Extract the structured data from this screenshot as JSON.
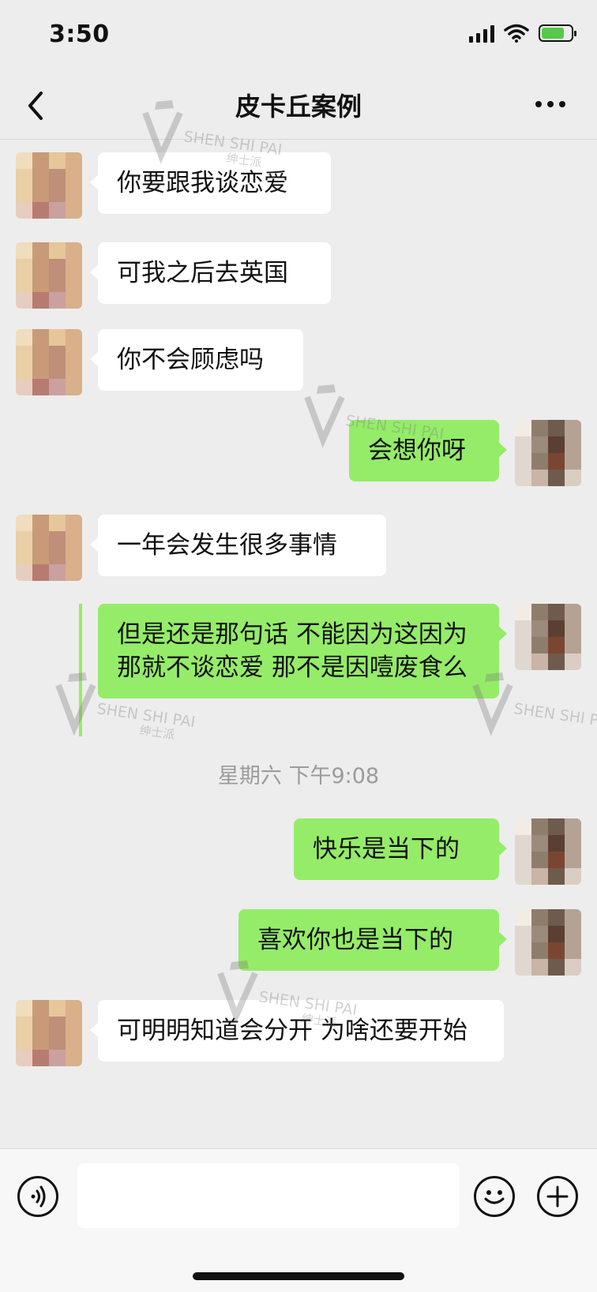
{
  "status_bar": {
    "time": "3:50"
  },
  "header": {
    "title": "皮卡丘案例",
    "back_icon": "chevron-left-icon",
    "more_icon": "more-dots-icon"
  },
  "messages": [
    {
      "side": "in",
      "text": "你要跟我谈恋爱"
    },
    {
      "side": "in",
      "text": "可我之后去英国"
    },
    {
      "side": "in",
      "text": "你不会顾虑吗"
    },
    {
      "side": "out",
      "text": "会想你呀"
    },
    {
      "side": "in",
      "text": "一年会发生很多事情"
    },
    {
      "side": "out",
      "text": "但是还是那句话 不能因为这因为那就不谈恋爱 那不是因噎废食么"
    },
    {
      "type": "timestamp",
      "text": "星期六 下午9:08"
    },
    {
      "side": "out",
      "text": "快乐是当下的"
    },
    {
      "side": "out",
      "text": "喜欢你也是当下的"
    },
    {
      "side": "in",
      "text": "可明明知道会分开 为啥还要开始"
    }
  ],
  "watermark": {
    "brand_en": "SHEN SHI PAI",
    "brand_cn": "绅士派"
  },
  "input_bar": {
    "voice_icon": "voice-icon",
    "emoji_icon": "emoji-icon",
    "plus_icon": "plus-icon",
    "value": ""
  },
  "colors": {
    "outgoing_bubble": "#95ec69",
    "incoming_bubble": "#ffffff",
    "background": "#ededed"
  }
}
